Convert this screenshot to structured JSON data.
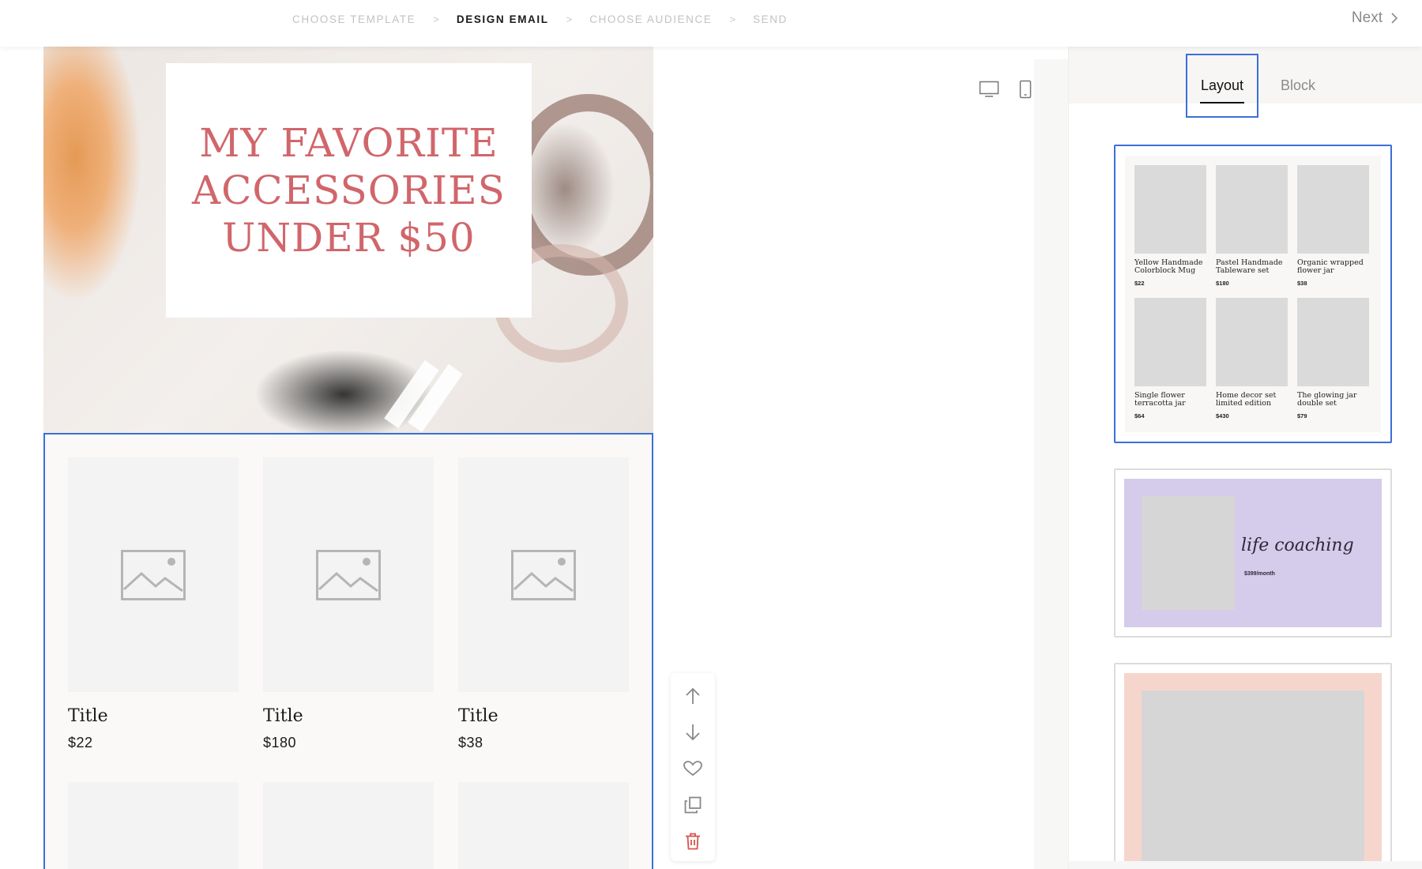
{
  "steps": [
    {
      "label": "CHOOSE TEMPLATE"
    },
    {
      "label": "DESIGN EMAIL"
    },
    {
      "label": "CHOOSE AUDIENCE"
    },
    {
      "label": "SEND"
    }
  ],
  "step_separator": ">",
  "next": {
    "label": "Next",
    "icon": "chevron-right-icon"
  },
  "hero": {
    "title": "MY FAVORITE ACCESSORIES UNDER $50"
  },
  "products": [
    {
      "title": "Title",
      "price": "$22"
    },
    {
      "title": "Title",
      "price": "$180"
    },
    {
      "title": "Title",
      "price": "$38"
    }
  ],
  "actions": [
    "arrow-up-icon",
    "arrow-down-icon",
    "heart-icon",
    "duplicate-icon",
    "trash-icon"
  ],
  "panel": {
    "tabs": [
      {
        "label": "Layout"
      },
      {
        "label": "Block"
      }
    ],
    "preset1_items": [
      {
        "name": "Yellow Handmade Colorblock Mug",
        "price": "$22"
      },
      {
        "name": "Pastel Handmade Tableware set",
        "price": "$180"
      },
      {
        "name": "Organic wrapped flower jar",
        "price": "$38"
      },
      {
        "name": "Single flower terracotta jar",
        "price": "$64"
      },
      {
        "name": "Home decor set limited edition",
        "price": "$430"
      },
      {
        "name": "The glowing jar double set",
        "price": "$79"
      }
    ],
    "preset2": {
      "script": "life coaching",
      "price": "$399/month"
    }
  },
  "colors": {
    "accent": "#3a6fd8",
    "hero_title": "#d0666b",
    "delete": "#d9534f",
    "preset2_bg": "#d5cbea",
    "preset3_bg": "#f6d6cc"
  }
}
